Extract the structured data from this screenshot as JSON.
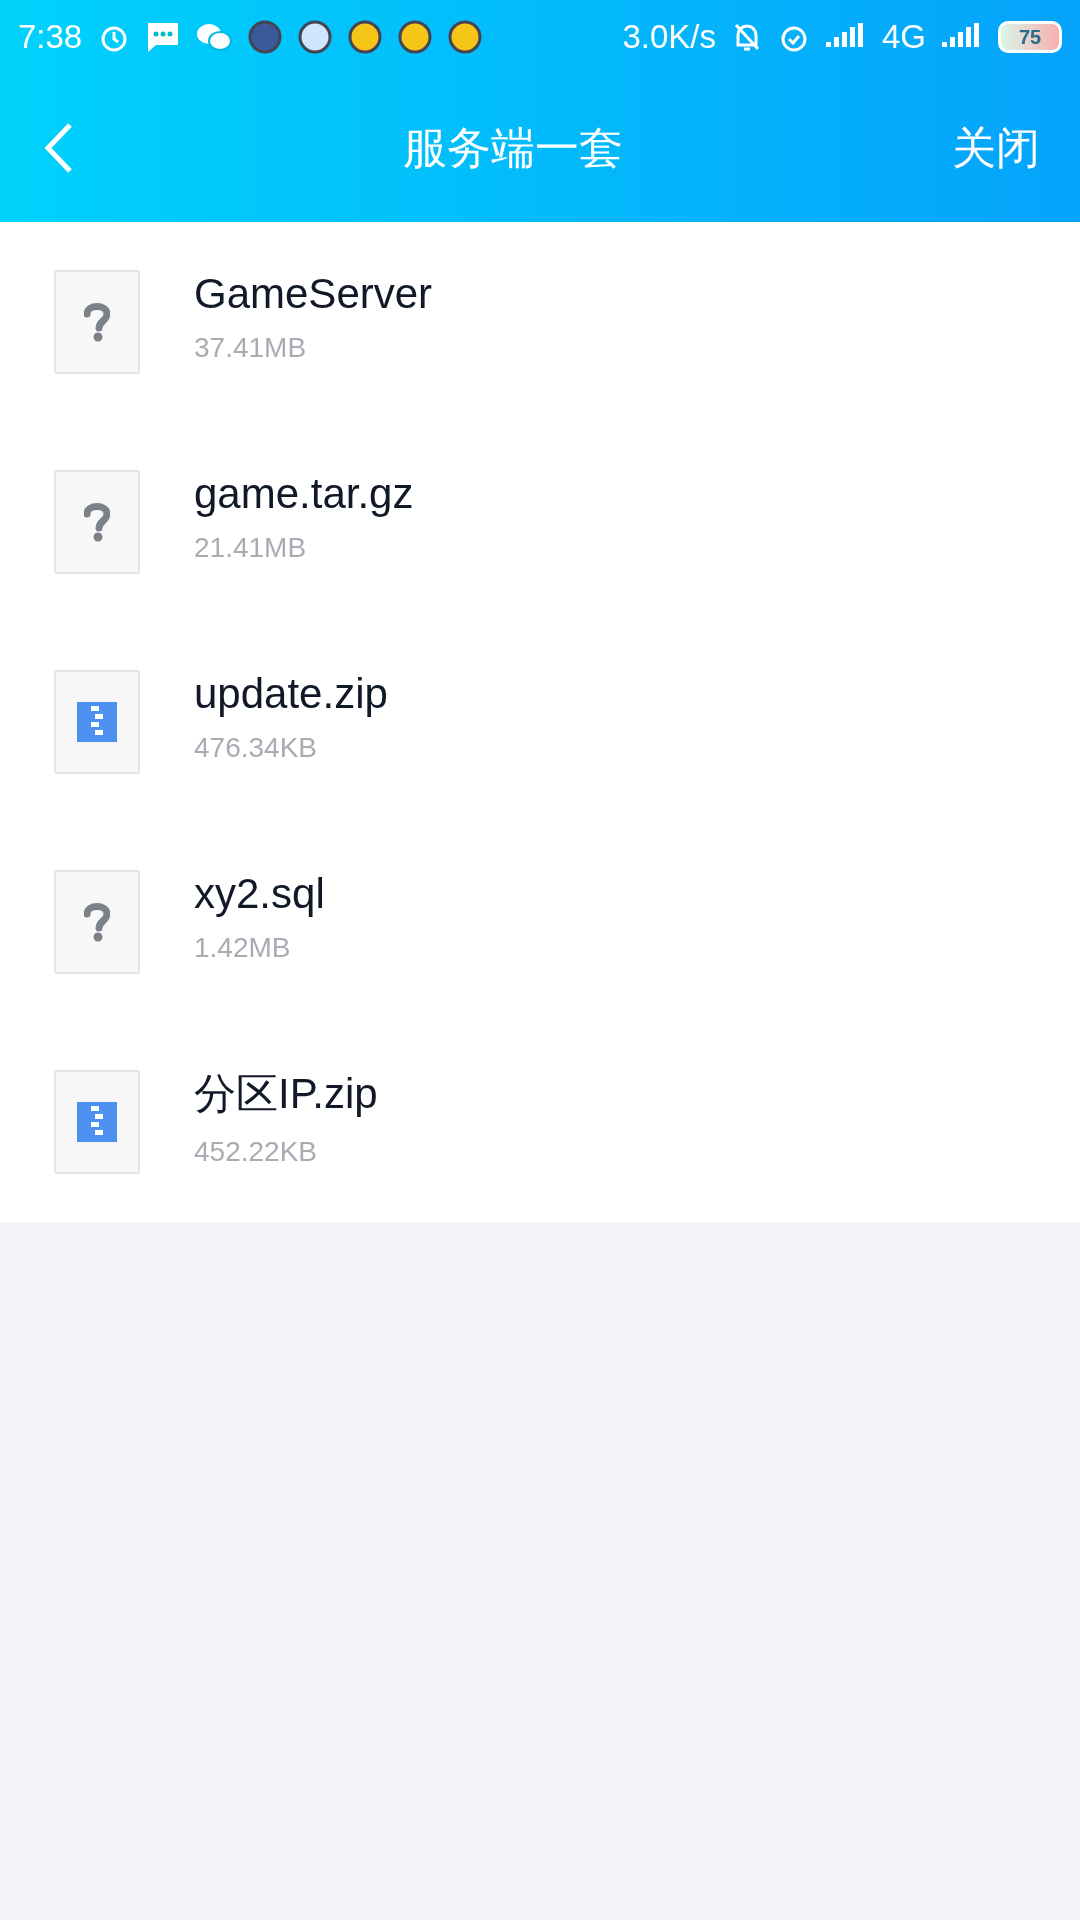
{
  "status_bar": {
    "time": "7:38",
    "speed": "3.0K/s",
    "network": "4G",
    "battery": "75"
  },
  "header": {
    "title": "服务端一套",
    "action": "关闭"
  },
  "files": [
    {
      "name": "GameServer",
      "size": "37.41MB",
      "kind": "unknown"
    },
    {
      "name": "game.tar.gz",
      "size": "21.41MB",
      "kind": "unknown"
    },
    {
      "name": "update.zip",
      "size": "476.34KB",
      "kind": "zip"
    },
    {
      "name": "xy2.sql",
      "size": "1.42MB",
      "kind": "unknown"
    },
    {
      "name": "分区IP.zip",
      "size": "452.22KB",
      "kind": "zip"
    }
  ]
}
